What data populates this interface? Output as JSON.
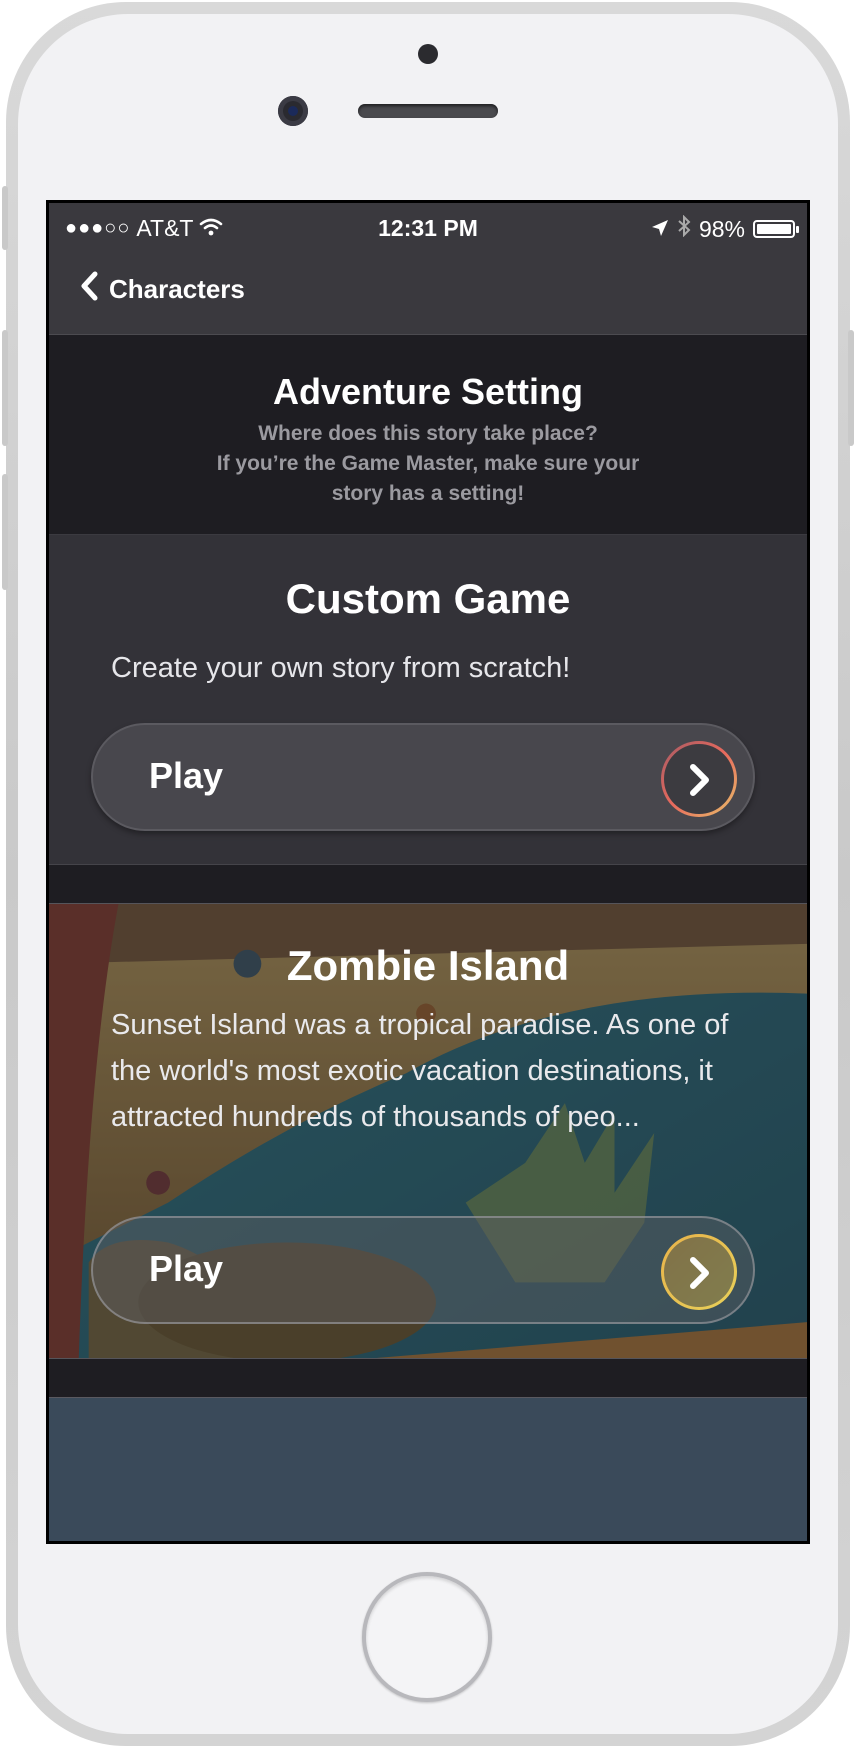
{
  "status_bar": {
    "signal": "●●●○○",
    "carrier": "AT&T",
    "time": "12:31 PM",
    "battery_percent": "98%"
  },
  "nav": {
    "back_label": "Characters"
  },
  "header": {
    "title": "Adventure Setting",
    "subtitle_line1": "Where does this story take place?",
    "subtitle_line2": "If you’re the Game Master, make sure your",
    "subtitle_line3": "story has a setting!"
  },
  "settings": [
    {
      "title": "Custom Game",
      "description": "Create your own story from scratch!",
      "play_label": "Play"
    },
    {
      "title": "Zombie Island",
      "description": "Sunset Island was a tropical paradise. As one of the world's most exotic vacation destinations, it attracted hundreds of thousands of peo...",
      "play_label": "Play"
    }
  ],
  "colors": {
    "nav_background": "#3a393e",
    "screen_background": "#1e1d22",
    "card_background": "#333238",
    "accent_gradient_start": "#e86a5d",
    "accent_gradient_end": "#e8c16a"
  },
  "icons": {
    "back": "chevron-left-icon",
    "wifi": "wifi-icon",
    "location": "location-arrow-icon",
    "bluetooth": "bluetooth-icon",
    "battery": "battery-icon",
    "play_arrow": "chevron-right-icon"
  }
}
